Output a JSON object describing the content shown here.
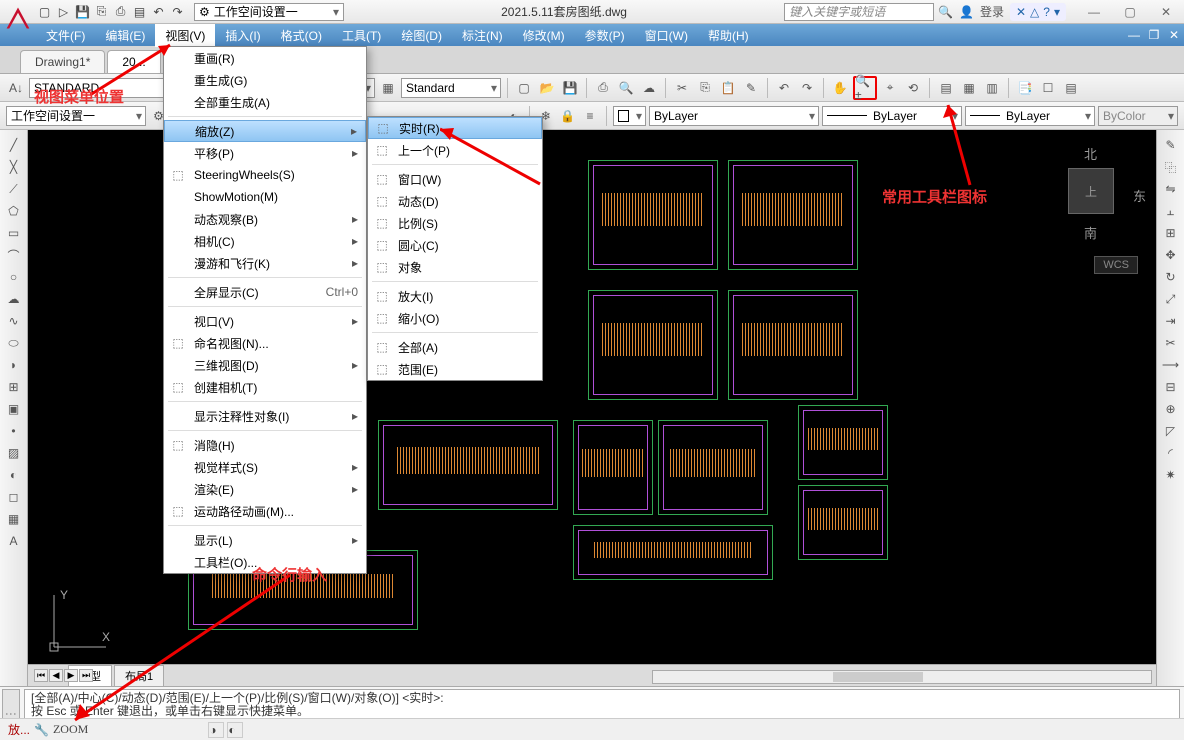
{
  "title": "2021.5.11套房图纸.dwg",
  "workspace_selector": "工作空间设置一",
  "search_placeholder": "键入关键字或短语",
  "login_label": "登录",
  "menubar": [
    "文件(F)",
    "编辑(E)",
    "视图(V)",
    "插入(I)",
    "格式(O)",
    "工具(T)",
    "绘图(D)",
    "标注(N)",
    "修改(M)",
    "参数(P)",
    "窗口(W)",
    "帮助(H)"
  ],
  "active_menu_index": 2,
  "draw_tabs": [
    "Drawing1*",
    "20..."
  ],
  "active_drawtab": 1,
  "styles_row": {
    "text_style": "STANDARD",
    "dim_style": "Standard"
  },
  "props_row": {
    "workspace_label": "工作空间设置一",
    "layer": "ByLayer",
    "linetype": "ByLayer",
    "lineweight": "ByLayer",
    "plotstyle": "ByColor"
  },
  "viewcube": {
    "top": "北",
    "right": "东",
    "bottom": "南",
    "face": "上",
    "wcs": "WCS"
  },
  "axis": {
    "y": "Y",
    "x": "X"
  },
  "sheet_tabs": [
    "模型",
    "布局1"
  ],
  "active_sheet": 0,
  "view_menu": [
    {
      "label": "重画(R)"
    },
    {
      "label": "重生成(G)"
    },
    {
      "label": "全部重生成(A)"
    },
    {
      "sep": true
    },
    {
      "label": "缩放(Z)",
      "sub": true,
      "highlight": true
    },
    {
      "label": "平移(P)",
      "sub": true
    },
    {
      "label": "SteeringWheels(S)",
      "icon": "wheel"
    },
    {
      "label": "ShowMotion(M)"
    },
    {
      "label": "动态观察(B)",
      "sub": true
    },
    {
      "label": "相机(C)",
      "sub": true
    },
    {
      "label": "漫游和飞行(K)",
      "sub": true
    },
    {
      "sep": true
    },
    {
      "label": "全屏显示(C)",
      "shortcut": "Ctrl+0"
    },
    {
      "sep": true
    },
    {
      "label": "视口(V)",
      "sub": true
    },
    {
      "label": "命名视图(N)...",
      "icon": "named"
    },
    {
      "label": "三维视图(D)",
      "sub": true
    },
    {
      "label": "创建相机(T)",
      "icon": "camera"
    },
    {
      "sep": true
    },
    {
      "label": "显示注释性对象(I)",
      "sub": true
    },
    {
      "sep": true
    },
    {
      "label": "消隐(H)",
      "icon": "hide"
    },
    {
      "label": "视觉样式(S)",
      "sub": true
    },
    {
      "label": "渲染(E)",
      "sub": true
    },
    {
      "label": "运动路径动画(M)...",
      "icon": "motion"
    },
    {
      "sep": true
    },
    {
      "label": "显示(L)",
      "sub": true
    },
    {
      "label": "工具栏(O)..."
    }
  ],
  "zoom_menu": [
    {
      "label": "实时(R)",
      "icon": "rt",
      "highlight": true
    },
    {
      "label": "上一个(P)",
      "icon": "prev"
    },
    {
      "sep": true
    },
    {
      "label": "窗口(W)",
      "icon": "win"
    },
    {
      "label": "动态(D)",
      "icon": "dyn"
    },
    {
      "label": "比例(S)",
      "icon": "scale"
    },
    {
      "label": "圆心(C)",
      "icon": "cen"
    },
    {
      "label": "对象",
      "icon": "obj"
    },
    {
      "sep": true
    },
    {
      "label": "放大(I)",
      "icon": "in"
    },
    {
      "label": "缩小(O)",
      "icon": "out"
    },
    {
      "sep": true
    },
    {
      "label": "全部(A)",
      "icon": "all"
    },
    {
      "label": "范围(E)",
      "icon": "ext"
    }
  ],
  "cmd": {
    "history_l1": "[全部(A)/中心(C)/动态(D)/范围(E)/上一个(P)/比例(S)/窗口(W)/对象(O)] <实时>:",
    "history_l2": "按 Esc 或 Enter 键退出，或单击右键显示快捷菜单。",
    "prompt": "▸_",
    "input_value": "ZOOM"
  },
  "status": {
    "cmd": "放...",
    "cmd2": "ZOOM"
  },
  "annotations": {
    "a1": "视图菜单位置",
    "a2": "常用工具栏图标",
    "a3": "命令行输入"
  }
}
